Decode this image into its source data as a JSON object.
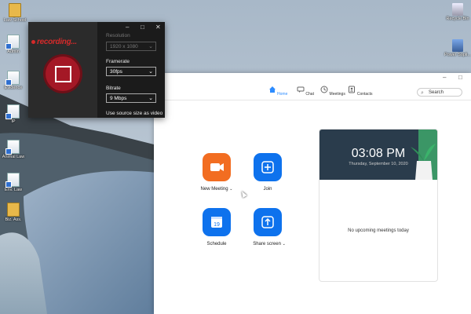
{
  "desktop": {
    "icons_left": [
      {
        "label": "Law School",
        "kind": "folder"
      },
      {
        "label": "Admin",
        "kind": "doc"
      },
      {
        "label": "Evidence",
        "kind": "doc"
      },
      {
        "label": "IP",
        "kind": "doc"
      },
      {
        "label": "Animal Law",
        "kind": "doc"
      },
      {
        "label": "Env. Law",
        "kind": "doc"
      },
      {
        "label": "Biz. Ass.",
        "kind": "folder"
      }
    ],
    "icons_right": [
      {
        "label": "Recycle Bin",
        "kind": "bin"
      },
      {
        "label": "Power Sopli...",
        "kind": "app"
      }
    ]
  },
  "recorder": {
    "title": "recording...",
    "resolution_label": "Resolution",
    "resolution_value": "1920 x 1080",
    "framerate_label": "Framerate",
    "framerate_value": "30fps",
    "bitrate_label": "Bitrate",
    "bitrate_value": "9 Mbps",
    "source_size_label": "Use source size as video"
  },
  "zoom": {
    "nav": [
      {
        "label": "Home",
        "icon": "home-icon",
        "active": true
      },
      {
        "label": "Chat",
        "icon": "chat-icon",
        "active": false
      },
      {
        "label": "Meetings",
        "icon": "clock-icon",
        "active": false
      },
      {
        "label": "Contacts",
        "icon": "contacts-icon",
        "active": false
      }
    ],
    "search_placeholder": "Search",
    "actions": {
      "new_meeting": "New Meeting",
      "join": "Join",
      "schedule": "Schedule",
      "schedule_day": "19",
      "share_screen": "Share screen"
    },
    "card": {
      "time": "03:08 PM",
      "date": "Thursday, September 10, 2020",
      "empty": "No upcoming meetings today"
    },
    "colors": {
      "accent": "#2d8cff",
      "orange": "#f26d21",
      "blue": "#0e72ed"
    }
  }
}
